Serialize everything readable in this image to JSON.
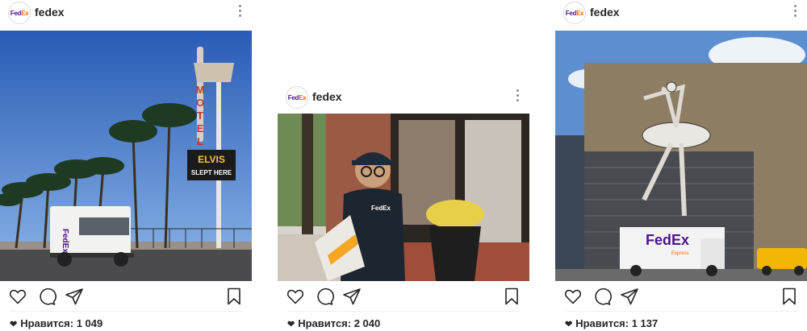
{
  "posts": [
    {
      "username": "fedex",
      "avatar_text": [
        "Fed",
        "Ex"
      ],
      "likes_label": "Нравится: 1 049",
      "photo": {
        "alt": "",
        "van_text": "FedEx",
        "sign_1": "ELVIS",
        "sign_2": "SLEPT HERE",
        "motel": "MOTEL"
      }
    },
    {
      "username": "fedex",
      "avatar_text": [
        "Fed",
        "Ex"
      ],
      "likes_label": "Нравится: 2 040",
      "photo": {
        "shirt_text": "FedEx"
      }
    },
    {
      "username": "fedex",
      "avatar_text": [
        "Fed",
        "Ex"
      ],
      "likes_label": "Нравится: 1 137",
      "photo": {
        "truck_text": "FedEx",
        "truck_sub": "Express"
      }
    }
  ],
  "icons": [
    "heart-icon",
    "comment-icon",
    "share-icon",
    "bookmark-icon",
    "more-options-icon",
    "likes-heart-icon"
  ],
  "colors": {
    "fedex_purple": "#4d148c",
    "fedex_orange": "#ff6600",
    "text": "#262626",
    "muted": "#8e8e8e"
  }
}
